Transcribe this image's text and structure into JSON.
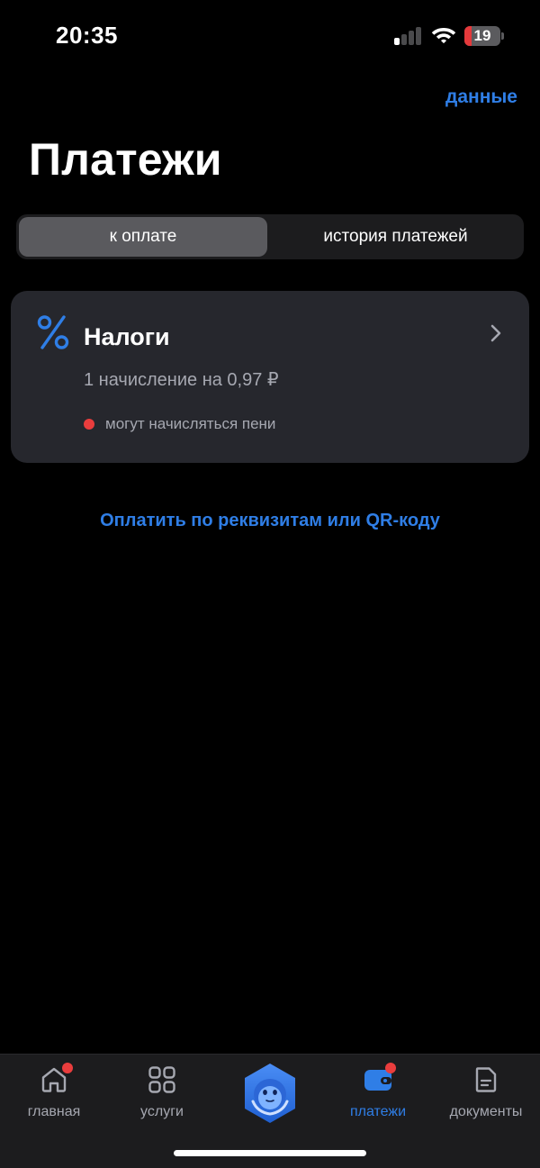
{
  "status_bar": {
    "time": "20:35",
    "battery_level": "19",
    "battery_fraction": 0.19,
    "signal_bars_active": 1,
    "signal_bars_total": 4
  },
  "header": {
    "data_link": "данные",
    "title": "Платежи"
  },
  "segmented": {
    "tabs": [
      {
        "label": "к оплате",
        "selected": true
      },
      {
        "label": "история платежей",
        "selected": false
      }
    ]
  },
  "card": {
    "icon": "percent-icon",
    "title": "Налоги",
    "subtitle": "1 начисление на 0,97 ₽",
    "warning": "могут начисляться пени"
  },
  "pay_link": "Оплатить по реквизитам или QR-коду",
  "tab_bar": {
    "items": [
      {
        "label": "главная",
        "icon": "home-icon",
        "badge": true,
        "active": false
      },
      {
        "label": "услуги",
        "icon": "grid-icon",
        "badge": false,
        "active": false
      },
      {
        "label": "",
        "icon": "assistant-icon",
        "badge": false,
        "active": false
      },
      {
        "label": "платежи",
        "icon": "wallet-icon",
        "badge": true,
        "active": true
      },
      {
        "label": "документы",
        "icon": "document-icon",
        "badge": false,
        "active": false
      }
    ]
  },
  "colors": {
    "accent": "#2f7ee6",
    "background": "#000000",
    "card": "#26272d",
    "secondary_text": "#a6a8b1",
    "alert": "#ea3d3d"
  }
}
